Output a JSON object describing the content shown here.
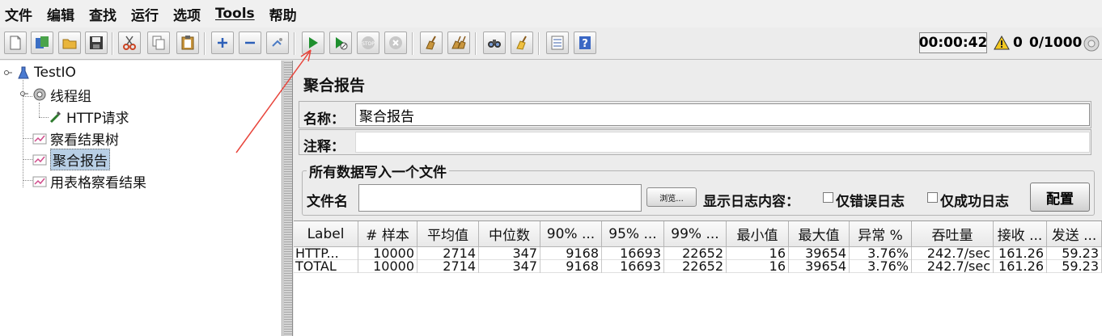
{
  "menu": [
    "文件",
    "编辑",
    "查找",
    "运行",
    "选项",
    "Tools",
    "帮助"
  ],
  "toolbar": {
    "buttons": [
      "new-icon",
      "templates-icon",
      "open-icon",
      "save-icon",
      "cut-icon",
      "copy-icon",
      "paste-icon",
      "expand-icon",
      "collapse-icon",
      "toggle-icon",
      "start-icon",
      "start-no-pause-icon",
      "stop-icon",
      "shutdown-icon",
      "clear-icon",
      "clear-all-icon",
      "search-icon",
      "reset-search-icon",
      "function-helper-icon",
      "help-icon"
    ],
    "timer": "00:00:42",
    "warning_count": "0",
    "thread_count": "0/1000"
  },
  "tree": {
    "root": "TestIO",
    "thread_group": "线程组",
    "http_request": "HTTP请求",
    "view_results_tree": "察看结果树",
    "aggregate_report": "聚合报告",
    "view_results_table": "用表格察看结果"
  },
  "panel": {
    "title": "聚合报告",
    "name_label": "名称：",
    "name_value": "聚合报告",
    "comment_label": "注释：",
    "comment_value": "",
    "file_group_title": "所有数据写入一个文件",
    "file_label": "文件名",
    "file_value": "",
    "browse_label": "浏览...",
    "log_content_label": "显示日志内容：",
    "errors_only_label": "仅错误日志",
    "success_only_label": "仅成功日志",
    "config_label": "配置"
  },
  "table": {
    "headers": [
      "Label",
      "# 样本",
      "平均值",
      "中位数",
      "90% ...",
      "95% ...",
      "99% ...",
      "最小值",
      "最大值",
      "异常 %",
      "吞吐量",
      "接收 ...",
      "发送 ..."
    ],
    "rows": [
      [
        "HTTP...",
        "10000",
        "2714",
        "347",
        "9168",
        "16693",
        "22652",
        "16",
        "39654",
        "3.76%",
        "242.7/sec",
        "161.26",
        "59.23"
      ],
      [
        "TOTAL",
        "10000",
        "2714",
        "347",
        "9168",
        "16693",
        "22652",
        "16",
        "39654",
        "3.76%",
        "242.7/sec",
        "161.26",
        "59.23"
      ]
    ]
  },
  "colors": {
    "annotation_arrow": "#e8453c",
    "selection": "#b8cfe5",
    "start_green": "#1e8f2e"
  }
}
